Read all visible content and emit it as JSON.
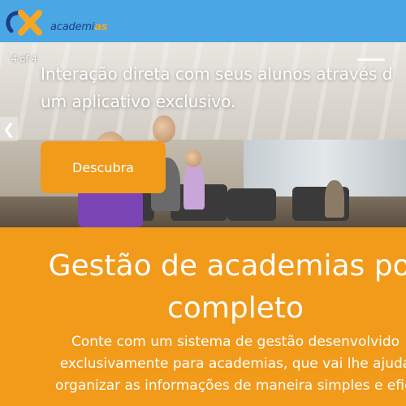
{
  "header": {
    "logo_text_main": "academi",
    "logo_text_accent": "as",
    "brand_color": "#4aa7e3"
  },
  "slider": {
    "counter_current": "4",
    "counter_sep": "of",
    "counter_total": "4",
    "headline_line1": "Interação direta com seus alunos através d",
    "headline_line2": "um aplicativo exclusivo.",
    "cta_label": "Descubra",
    "prev_icon": "chevron-left-icon"
  },
  "content": {
    "title_line1": "Gestão de academias por",
    "title_line2": "completo",
    "desc_line1": "Conte com um sistema de gestão desenvolvido",
    "desc_line2": "exclusivamente para academias, que vai lhe ajuda",
    "desc_line3": "organizar as informações de maneira simples e efici",
    "accent_color": "#f29a1a"
  }
}
